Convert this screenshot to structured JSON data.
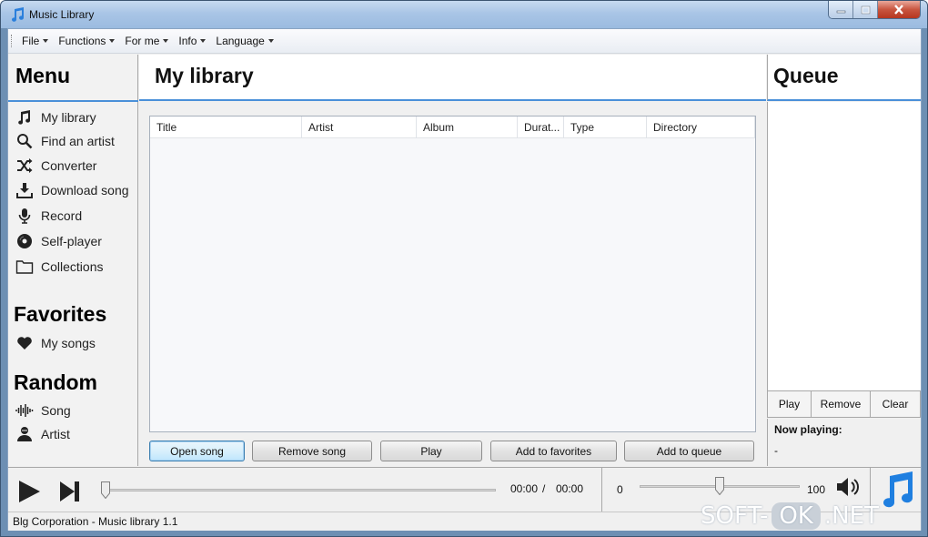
{
  "window": {
    "title": "Music Library"
  },
  "menubar": [
    "File",
    "Functions",
    "For me",
    "Info",
    "Language"
  ],
  "menu_panel": {
    "menu_title": "Menu",
    "items": [
      "My library",
      "Find an artist",
      "Converter",
      "Download song",
      "Record",
      "Self-player",
      "Collections"
    ],
    "favorites_title": "Favorites",
    "favorites": [
      "My songs"
    ],
    "random_title": "Random",
    "random": [
      "Song",
      "Artist"
    ]
  },
  "library": {
    "title": "My library",
    "columns": [
      "Title",
      "Artist",
      "Album",
      "Durat...",
      "Type",
      "Directory"
    ],
    "buttons": {
      "open": "Open song",
      "remove": "Remove song",
      "play": "Play",
      "favorites": "Add to favorites",
      "queue": "Add to queue"
    }
  },
  "queue": {
    "title": "Queue",
    "buttons": {
      "play": "Play",
      "remove": "Remove",
      "clear": "Clear"
    },
    "now_playing_label": "Now playing:",
    "now_playing_value": "-"
  },
  "player": {
    "current_time": "00:00",
    "separator": "/",
    "total_time": "00:00",
    "seek_position": 0,
    "volume_min": "0",
    "volume_max": "100",
    "volume_level": 50
  },
  "status": {
    "text": "Blg Corporation - Music library 1.1"
  },
  "watermark": {
    "left": "SOFT-",
    "mid": "OK",
    "right": ".NET"
  },
  "colors": {
    "accent": "#4a90d9",
    "note_blue": "#1f7fe0"
  }
}
